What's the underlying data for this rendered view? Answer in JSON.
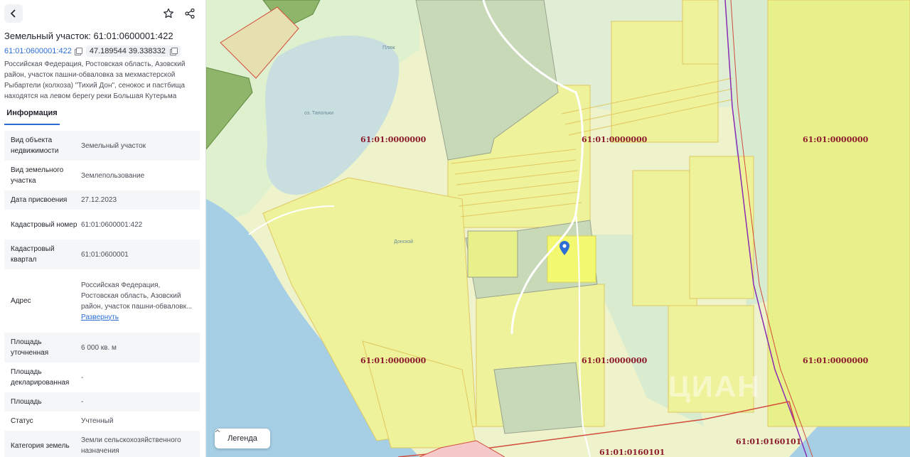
{
  "panel": {
    "title": "Земельный участок: 61:01:0600001:422",
    "cadastral_link": "61:01:0600001:422",
    "coordinates": "47.189544 39.338332",
    "address": "Российская Федерация, Ростовская область, Азовский район, участок пашни-обваловка за мехмастерской Рыбартели (колхоза) \"Тихий Дон\", сенокос и пастбища находятся на левом берегу реки Большая Кутерьма",
    "tab_info": "Информация"
  },
  "info": [
    {
      "key": "Вид объекта недвижимости",
      "value": "Земельный участок"
    },
    {
      "key": "Вид земельного участка",
      "value": "Землепользование"
    },
    {
      "key": "Дата присвоения",
      "value": "27.12.2023"
    },
    {
      "key": "Кадастровый номер",
      "value": "61:01:0600001:422"
    },
    {
      "key": "Кадастровый квартал",
      "value": "61:01:0600001"
    },
    {
      "key": "Адрес",
      "value": "Российская Федерация, Ростовская область, Азовский район, участок пашни-обваловк...",
      "expand": "Развернуть"
    },
    {
      "key": "Площадь уточненная",
      "value": "6 000 кв. м"
    },
    {
      "key": "Площадь декларированная",
      "value": "-"
    },
    {
      "key": "Площадь",
      "value": "-"
    },
    {
      "key": "Статус",
      "value": "Учтенный"
    },
    {
      "key": "Категория земель",
      "value": "Земли сельскохозяйственного назначения"
    }
  ],
  "map": {
    "labels": [
      "61:01:0000000",
      "61:01:0000000",
      "61:01:0000000",
      "61:01:0000000",
      "61:01:0000000",
      "61:01:0000000",
      "61:01:0160101",
      "61:01:0160101"
    ],
    "poi_beach": "Пляж",
    "poi_lake": "оз. Тапольки",
    "poi_place": "Донской",
    "legend": "Легенда",
    "watermark": "ЦИАН"
  },
  "colors": {
    "accent": "#2b6fd6",
    "parcel_yellow": "#e8f08a",
    "selected_parcel": "#eef57a",
    "water": "#a6cfe6",
    "cadastral_label": "#8c1b2e"
  }
}
